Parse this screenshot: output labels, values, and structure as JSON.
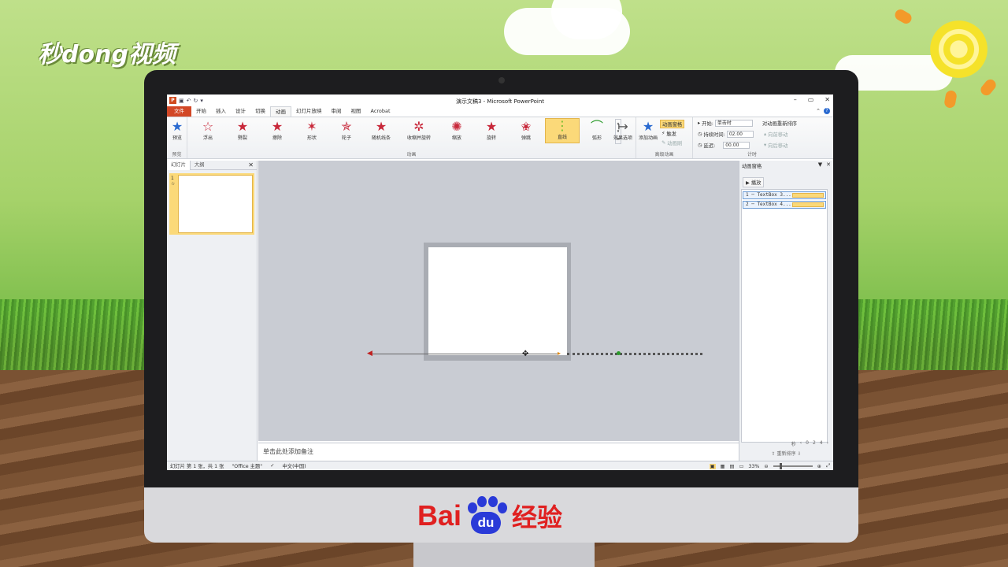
{
  "watermark": {
    "logo_text": "秒dong视频"
  },
  "footer_brand": {
    "bai": "Bai",
    "du": "du",
    "jingyan": "经验"
  },
  "app": {
    "title": "演示文稿3 - Microsoft PowerPoint",
    "qat": {
      "save": "▣",
      "undo": "↶",
      "redo": "↻",
      "customize": "▾"
    },
    "window": {
      "minimize": "–",
      "restore": "▭",
      "close": "✕"
    },
    "tabs": [
      {
        "label": "文件"
      },
      {
        "label": "开始"
      },
      {
        "label": "插入"
      },
      {
        "label": "设计"
      },
      {
        "label": "切换"
      },
      {
        "label": "动画"
      },
      {
        "label": "幻灯片放映"
      },
      {
        "label": "审阅"
      },
      {
        "label": "视图"
      },
      {
        "label": "Acrobat"
      }
    ],
    "active_tab": "动画"
  },
  "ribbon": {
    "preview": {
      "label": "预览",
      "group": "预览"
    },
    "animations_group": "动画",
    "effects": [
      {
        "label": "浮出",
        "icon": "star-icon"
      },
      {
        "label": "劈裂",
        "icon": "star-icon"
      },
      {
        "label": "擦除",
        "icon": "star-icon"
      },
      {
        "label": "形状",
        "icon": "star-icon"
      },
      {
        "label": "轮子",
        "icon": "star-icon"
      },
      {
        "label": "随机线条",
        "icon": "star-icon"
      },
      {
        "label": "收缩并旋转",
        "icon": "star-icon"
      },
      {
        "label": "缩放",
        "icon": "star-icon"
      },
      {
        "label": "旋转",
        "icon": "star-icon"
      },
      {
        "label": "弹跳",
        "icon": "star-icon"
      },
      {
        "label": "直线",
        "icon": "motion-path-icon"
      },
      {
        "label": "弧形",
        "icon": "arc-icon"
      }
    ],
    "selected_effect": "直线",
    "effect_options": "效果选项",
    "advanced": {
      "group": "高级动画",
      "add_animation": "添加动画",
      "animation_pane": "动画窗格",
      "trigger": "触发",
      "animation_painter": "动画刷"
    },
    "timing": {
      "group": "计时",
      "start_label": "开始:",
      "start_value": "单击时",
      "duration_label": "持续时间:",
      "duration_value": "02.00",
      "delay_label": "延迟:",
      "delay_value": "00.00",
      "reorder": "对动画重新排序",
      "move_earlier": "向前移动",
      "move_later": "向后移动"
    }
  },
  "left_pane": {
    "tab_slides": "幻灯片",
    "tab_outline": "大纲",
    "close": "✕",
    "slide_number": "1",
    "slide_marker": "☆"
  },
  "notes_placeholder": "单击此处添加备注",
  "animation_pane": {
    "title": "动画窗格",
    "play": "播放",
    "items": [
      {
        "label": "1 ─ TextBox 3..."
      },
      {
        "label": "2 ─ TextBox 4..."
      }
    ],
    "timeline": {
      "unit": "秒",
      "from": "0",
      "mid": "2",
      "to": "4"
    },
    "reorder_label": "重新排序"
  },
  "status": {
    "slide_info": "幻灯片 第 1 张，共 1 张",
    "theme": "\"Office 主题\"",
    "language": "中文(中国)",
    "zoom": "33%"
  }
}
